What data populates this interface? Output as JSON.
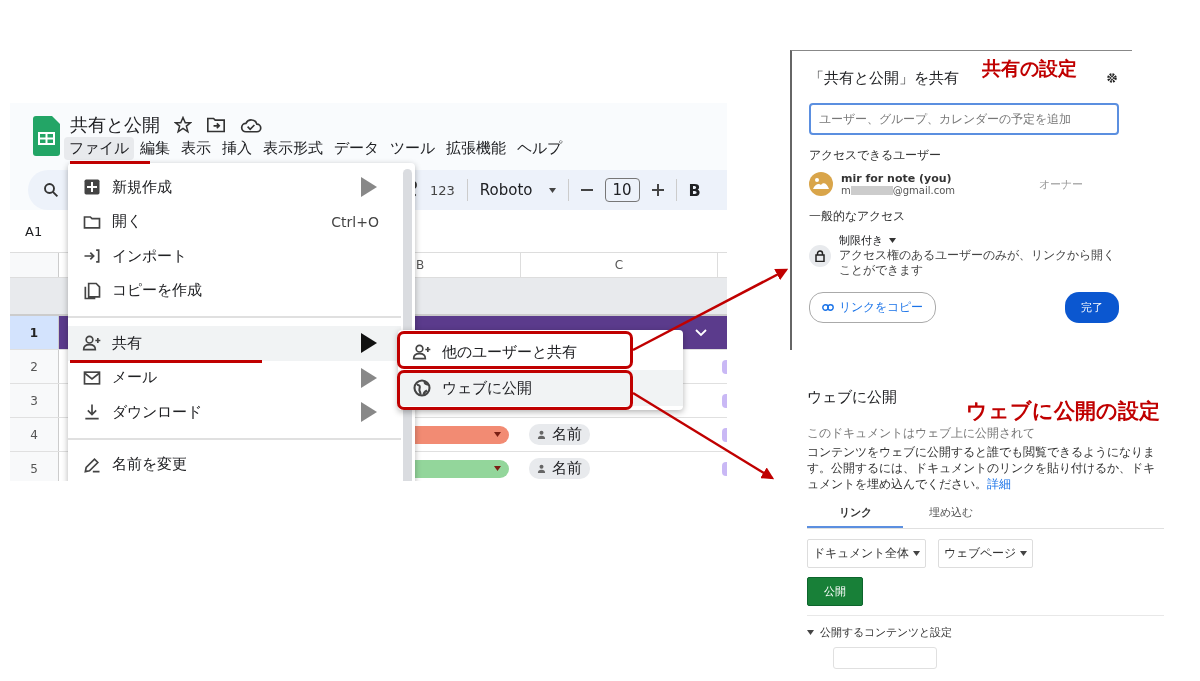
{
  "spreadsheet": {
    "title": "共有と公開",
    "menubar": [
      {
        "label": "ファイル",
        "selected": true
      },
      {
        "label": "編集",
        "selected": false
      },
      {
        "label": "表示",
        "selected": false
      },
      {
        "label": "挿入",
        "selected": false
      },
      {
        "label": "表示形式",
        "selected": false
      },
      {
        "label": "データ",
        "selected": false
      },
      {
        "label": "ツール",
        "selected": false
      },
      {
        "label": "拡張機能",
        "selected": false
      },
      {
        "label": "ヘルプ",
        "selected": false
      }
    ],
    "toolbar": {
      "number_format": "123",
      "font": "Roboto",
      "font_size": "10",
      "bold": "B"
    },
    "name_box": "A1",
    "columns": [
      "B",
      "C"
    ],
    "rows": [
      {
        "number": "1",
        "selected": true
      },
      {
        "number": "2",
        "selected": false
      },
      {
        "number": "3",
        "selected": false
      },
      {
        "number": "4",
        "selected": false,
        "color": "#f28b73",
        "owner": "名前"
      },
      {
        "number": "5",
        "selected": false,
        "color": "#93d69b",
        "owner": "名前"
      }
    ],
    "file_menu": [
      {
        "label": "新規作成",
        "submenu": true,
        "highlighted": false
      },
      {
        "label": "開く",
        "shortcut": "Ctrl+O",
        "submenu": false,
        "highlighted": false
      },
      {
        "label": "インポート",
        "submenu": false,
        "highlighted": false
      },
      {
        "label": "コピーを作成",
        "submenu": false,
        "highlighted": false,
        "divider_after": true
      },
      {
        "label": "共有",
        "submenu": true,
        "highlighted": true
      },
      {
        "label": "メール",
        "submenu": true,
        "highlighted": false
      },
      {
        "label": "ダウンロード",
        "submenu": true,
        "highlighted": false,
        "divider_after": true
      },
      {
        "label": "名前を変更",
        "submenu": false,
        "highlighted": false
      }
    ],
    "share_submenu": [
      {
        "label": "他のユーザーと共有",
        "highlighted": false
      },
      {
        "label": "ウェブに公開",
        "highlighted": true
      }
    ]
  },
  "share_dialog": {
    "caption": "共有の設定",
    "title": "「共有と公開」を共有",
    "placeholder": "ユーザー、グループ、カレンダーの予定を追加",
    "people_heading": "アクセスできるユーザー",
    "user": {
      "name": "mir for note (you)",
      "email_start": "m",
      "email_end": "@gmail.com",
      "role": "オーナー"
    },
    "general_heading": "一般的なアクセス",
    "access": {
      "level": "制限付き",
      "description": "アクセス権のあるユーザーのみが、リンクから開くことができます"
    },
    "copy_link": "リンクをコピー",
    "done": "完了"
  },
  "publish_dialog": {
    "caption": "ウェブに公開の設定",
    "title": "ウェブに公開",
    "status": "このドキュメントはウェブ上に公開されて",
    "description": "コンテンツをウェブに公開すると誰でも閲覧できるようになります。公開するには、ドキュメントのリンクを貼り付けるか、ドキュメントを埋め込んでください。",
    "learn_more": "詳細",
    "tabs": [
      {
        "label": "リンク",
        "selected": true
      },
      {
        "label": "埋め込む",
        "selected": false
      }
    ],
    "dropdowns": [
      "ドキュメント全体",
      "ウェブページ"
    ],
    "publish": "公開",
    "settings_section": "公開するコンテンツと設定"
  }
}
